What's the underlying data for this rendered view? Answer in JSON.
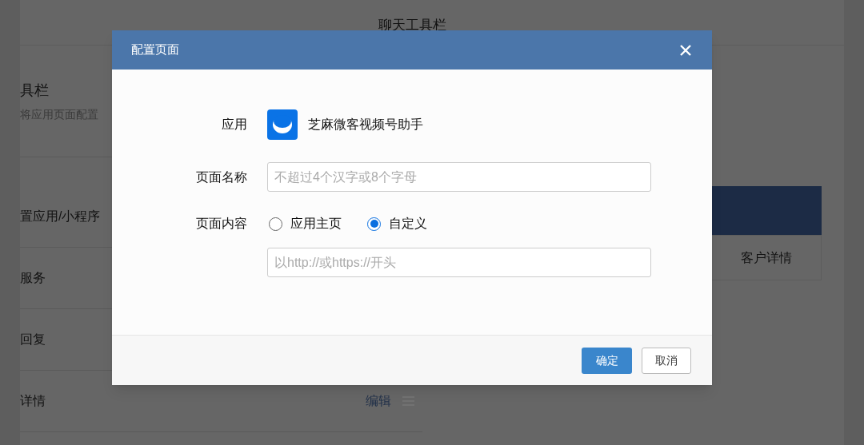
{
  "page": {
    "title": "聊天工具栏",
    "section_title": "具栏",
    "section_desc": "将应用页面配置",
    "list": [
      {
        "label": "置应用/小程序"
      },
      {
        "label": "服务"
      },
      {
        "label": "回复"
      },
      {
        "label": "详情",
        "action": "编辑"
      }
    ],
    "preview_tab": "客户详情"
  },
  "dialog": {
    "title": "配置页面",
    "app": {
      "label": "应用",
      "name": "芝麻微客视频号助手"
    },
    "page_name": {
      "label": "页面名称",
      "placeholder": "不超过4个汉字或8个字母"
    },
    "content": {
      "label": "页面内容",
      "options": [
        {
          "label": "应用主页",
          "selected": false
        },
        {
          "label": "自定义",
          "selected": true
        }
      ],
      "url_placeholder": "以http://或https://开头"
    },
    "buttons": [
      {
        "kind": "primary",
        "label": "确定"
      },
      {
        "kind": "default",
        "label": "取消"
      }
    ]
  }
}
